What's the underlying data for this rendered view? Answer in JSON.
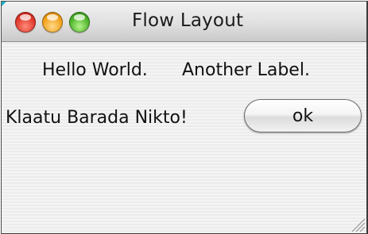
{
  "window": {
    "title": "Flow Layout",
    "controls": {
      "close_icon": "close-traffic-light",
      "minimize_icon": "minimize-traffic-light",
      "zoom_icon": "zoom-traffic-light"
    },
    "colors": {
      "close": "#e0382c",
      "minimize": "#f2a21c",
      "zoom": "#4fb52c"
    }
  },
  "content": {
    "labels": [
      "Hello World.",
      "Another Label.",
      "Klaatu Barada Nikto!"
    ],
    "button_label": "ok"
  }
}
